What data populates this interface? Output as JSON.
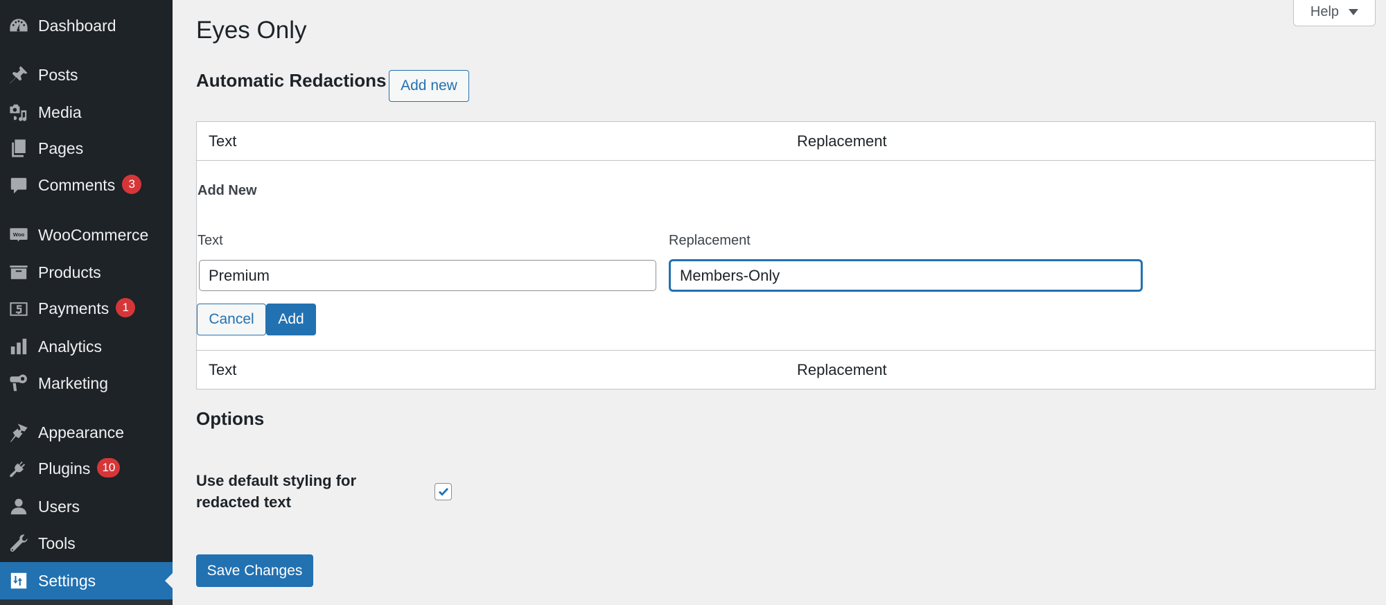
{
  "sidebar": {
    "items": [
      {
        "label": "Dashboard",
        "icon": "dashboard-icon"
      },
      {
        "label": "Posts",
        "icon": "pin-icon"
      },
      {
        "label": "Media",
        "icon": "media-icon"
      },
      {
        "label": "Pages",
        "icon": "pages-icon"
      },
      {
        "label": "Comments",
        "icon": "comment-icon",
        "badge": "3"
      },
      {
        "label": "WooCommerce",
        "icon": "woo-icon"
      },
      {
        "label": "Products",
        "icon": "archive-icon"
      },
      {
        "label": "Payments",
        "icon": "dollar-icon",
        "badge": "1"
      },
      {
        "label": "Analytics",
        "icon": "bar-chart-icon"
      },
      {
        "label": "Marketing",
        "icon": "megaphone-icon"
      },
      {
        "label": "Appearance",
        "icon": "paintbrush-icon"
      },
      {
        "label": "Plugins",
        "icon": "plug-icon",
        "badge": "10"
      },
      {
        "label": "Users",
        "icon": "user-icon"
      },
      {
        "label": "Tools",
        "icon": "wrench-icon"
      },
      {
        "label": "Settings",
        "icon": "settings-sliders-icon",
        "active": true
      }
    ]
  },
  "help": {
    "label": "Help"
  },
  "page": {
    "title": "Eyes Only",
    "section_heading": "Automatic Redactions",
    "add_new_label": "Add new"
  },
  "table": {
    "columns": [
      "Text",
      "Replacement"
    ],
    "add_form": {
      "title": "Add New",
      "text_label": "Text",
      "text_value": "Premium",
      "replacement_label": "Replacement",
      "replacement_value": "Members-Only",
      "cancel_label": "Cancel",
      "add_label": "Add"
    }
  },
  "options": {
    "heading": "Options",
    "default_styling_label": "Use default styling for redacted text",
    "default_styling_checked": true
  },
  "save_label": "Save Changes",
  "colors": {
    "accent": "#2271b1",
    "sidebar_bg": "#1d2327",
    "badge": "#d63638",
    "page_bg": "#f0f0f1"
  }
}
